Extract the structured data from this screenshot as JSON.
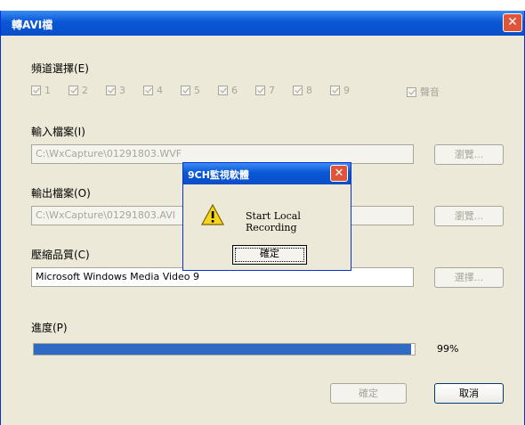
{
  "window": {
    "title": "轉AVI檔",
    "close": "✕"
  },
  "channels": {
    "label": "頻道選擇(E)",
    "items": [
      "1",
      "2",
      "3",
      "4",
      "5",
      "6",
      "7",
      "8",
      "9"
    ],
    "audio_label": "聲音"
  },
  "input": {
    "label": "輸入檔案(I)",
    "value": "C:\\WxCapture\\01291803.WVF",
    "browse": "瀏覽..."
  },
  "output": {
    "label": "輸出檔案(O)",
    "value": "C:\\WxCapture\\01291803.AVI",
    "browse": "瀏覽..."
  },
  "quality": {
    "label": "壓縮品質(C)",
    "value": "Microsoft Windows Media Video 9",
    "select": "選擇..."
  },
  "progress": {
    "label": "進度(P)",
    "percent_text": "99%",
    "fraction": 0.99
  },
  "buttons": {
    "ok": "確定",
    "cancel": "取消"
  },
  "dialog": {
    "title": "9CH監視軟體",
    "message": "Start Local Recording",
    "ok": "確定",
    "close": "✕"
  },
  "colors": {
    "titlebar": "#0a57d6",
    "progress": "#316ac5",
    "close": "#e0553a"
  }
}
